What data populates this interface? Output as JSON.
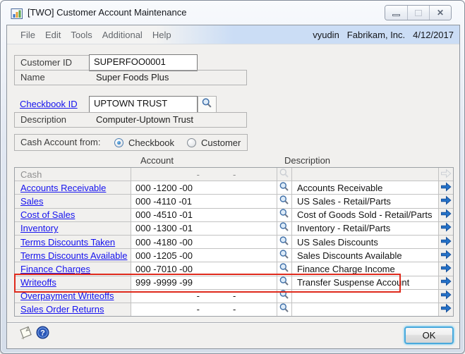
{
  "window": {
    "title": "[TWO] Customer Account Maintenance"
  },
  "menubar": {
    "items": [
      "File",
      "Edit",
      "Tools",
      "Additional",
      "Help"
    ],
    "user": "vyudin",
    "company": "Fabrikam, Inc.",
    "date": "4/12/2017"
  },
  "form": {
    "customer_id_label": "Customer ID",
    "customer_id_value": "SUPERFOO0001",
    "name_label": "Name",
    "name_value": "Super Foods Plus",
    "checkbook_id_label": "Checkbook ID",
    "checkbook_id_value": "UPTOWN TRUST",
    "description_label": "Description",
    "description_value": "Computer-Uptown Trust"
  },
  "cash_account_from": {
    "label": "Cash Account from:",
    "options": [
      {
        "label": "Checkbook",
        "selected": true
      },
      {
        "label": "Customer",
        "selected": false
      }
    ]
  },
  "table": {
    "account_header": "Account",
    "description_header": "Description",
    "rows": [
      {
        "label": "Cash",
        "account": "                        -             -",
        "description": "",
        "link": false,
        "disabled": true,
        "highlighted": false
      },
      {
        "label": "Accounts Receivable",
        "account": "000 -1200 -00",
        "description": "Accounts Receivable",
        "link": true,
        "disabled": false,
        "highlighted": false
      },
      {
        "label": "Sales",
        "account": "000 -4110 -01",
        "description": "US Sales - Retail/Parts",
        "link": true,
        "disabled": false,
        "highlighted": false
      },
      {
        "label": "Cost of Sales",
        "account": "000 -4510 -01",
        "description": "Cost of Goods Sold - Retail/Parts",
        "link": true,
        "disabled": false,
        "highlighted": false
      },
      {
        "label": "Inventory",
        "account": "000 -1300 -01",
        "description": "Inventory - Retail/Parts",
        "link": true,
        "disabled": false,
        "highlighted": false
      },
      {
        "label": "Terms Discounts Taken",
        "account": "000 -4180 -00",
        "description": "US Sales Discounts",
        "link": true,
        "disabled": false,
        "highlighted": false
      },
      {
        "label": "Terms Discounts Available",
        "account": "000 -1205 -00",
        "description": "Sales Discounts Available",
        "link": true,
        "disabled": false,
        "highlighted": false
      },
      {
        "label": "Finance Charges",
        "account": "000 -7010 -00",
        "description": "Finance Charge Income",
        "link": true,
        "disabled": false,
        "highlighted": false
      },
      {
        "label": "Writeoffs",
        "account": "999 -9999 -99",
        "description": "Transfer Suspense Account",
        "link": true,
        "disabled": false,
        "highlighted": true
      },
      {
        "label": "Overpayment Writeoffs",
        "account": "                        -             -",
        "description": "",
        "link": true,
        "disabled": false,
        "highlighted": false
      },
      {
        "label": "Sales Order Returns",
        "account": "                        -             -",
        "description": "",
        "link": true,
        "disabled": false,
        "highlighted": false
      }
    ]
  },
  "footer": {
    "ok_label": "OK"
  },
  "icons": {
    "app": "dynamics-gp-chart",
    "minimize": "minimize-bar",
    "maximize": "restore-box",
    "close": "close-x",
    "lookup": "magnifier",
    "row_open": "arrow-right",
    "note": "notepad",
    "help": "question-mark"
  },
  "colors": {
    "link": "#1512EE",
    "highlight": "#DF2A1C",
    "arrow": "#2573C9",
    "menu_blue": "#CBDDF5"
  }
}
